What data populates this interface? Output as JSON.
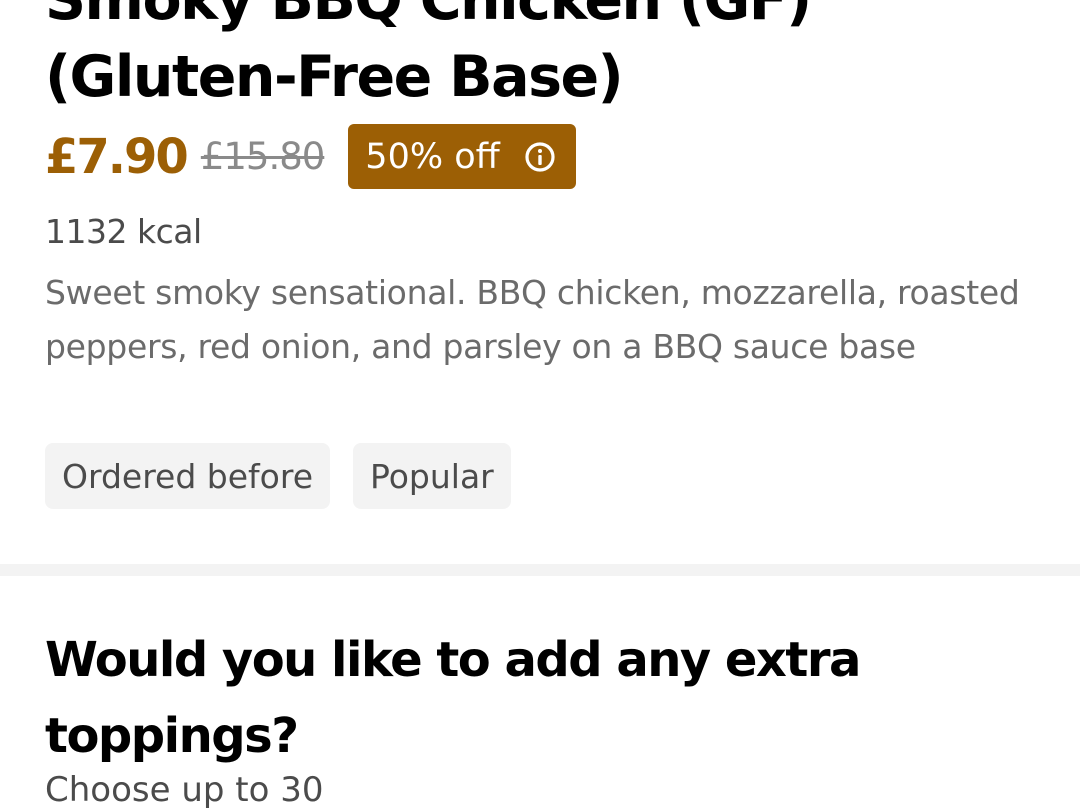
{
  "item": {
    "title_line1": "Smoky BBQ Chicken (GF)",
    "title_line2": "(Gluten-Free Base)",
    "price": "£7.90",
    "original_price": "£15.80",
    "discount_label": "50% off",
    "calories": "1132 kcal",
    "description": "Sweet smoky sensational. BBQ chicken, mozzarella, roasted peppers, red onion, and parsley on a BBQ sauce base",
    "tags": [
      "Ordered before",
      "Popular"
    ]
  },
  "options_section": {
    "title_line1": "Would you like to add any extra",
    "title_line2": "toppings?",
    "subtitle": "Choose up to 30"
  },
  "icons": {
    "discount_info": "info-icon"
  },
  "colors": {
    "accent": "#9c5f05",
    "tag_background": "#f3f3f3",
    "divider": "#f3f3f3",
    "strikethrough_price": "#8a8a8a",
    "description_text": "#6b6b6b"
  }
}
